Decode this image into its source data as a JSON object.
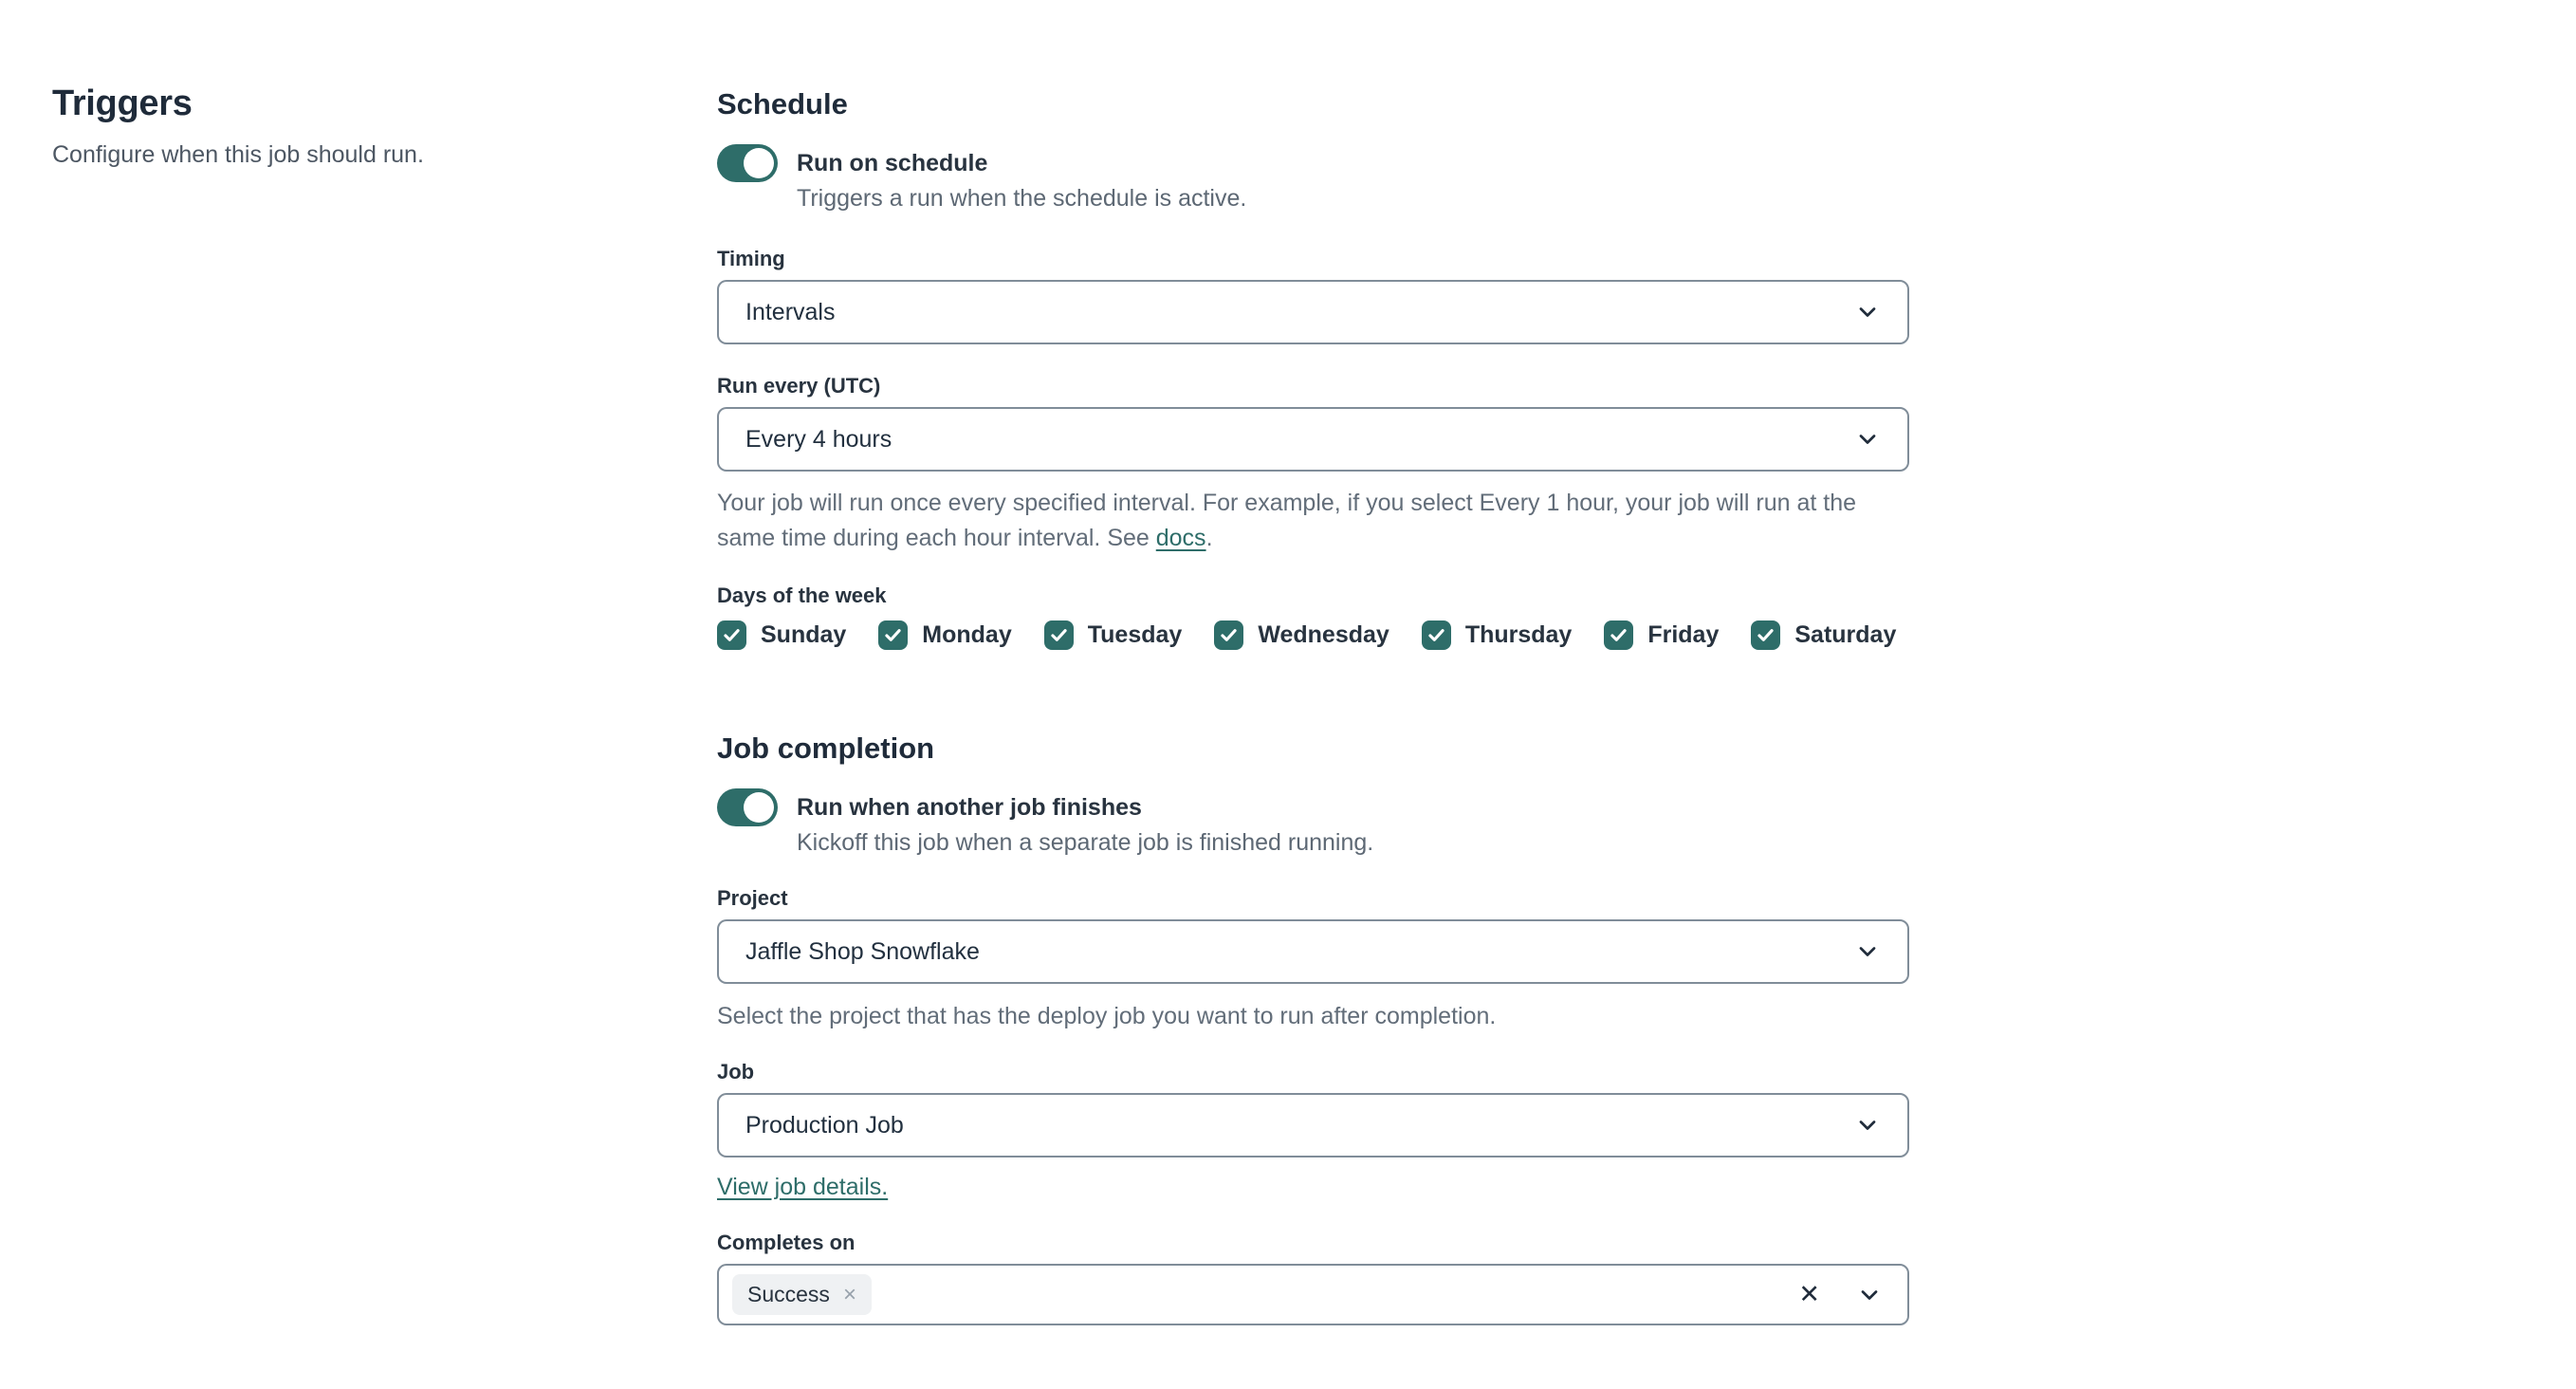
{
  "left": {
    "title": "Triggers",
    "subtitle": "Configure when this job should run."
  },
  "schedule": {
    "heading": "Schedule",
    "toggle": {
      "label": "Run on schedule",
      "description": "Triggers a run when the schedule is active.",
      "state": "on"
    },
    "timing": {
      "label": "Timing",
      "value": "Intervals"
    },
    "run_every": {
      "label": "Run every (UTC)",
      "value": "Every 4 hours",
      "help_before": "Your job will run once every specified interval. For example, if you select Every 1 hour, your job will run at the same time during each hour interval. See ",
      "help_link": "docs",
      "help_after": "."
    },
    "days": {
      "label": "Days of the week",
      "items": [
        {
          "label": "Sunday",
          "checked": true
        },
        {
          "label": "Monday",
          "checked": true
        },
        {
          "label": "Tuesday",
          "checked": true
        },
        {
          "label": "Wednesday",
          "checked": true
        },
        {
          "label": "Thursday",
          "checked": true
        },
        {
          "label": "Friday",
          "checked": true
        },
        {
          "label": "Saturday",
          "checked": true
        }
      ]
    }
  },
  "job_completion": {
    "heading": "Job completion",
    "toggle": {
      "label": "Run when another job finishes",
      "description": "Kickoff this job when a separate job is finished running.",
      "state": "on"
    },
    "project": {
      "label": "Project",
      "value": "Jaffle Shop Snowflake",
      "help": "Select the project that has the deploy job you want to run after completion."
    },
    "job": {
      "label": "Job",
      "value": "Production Job",
      "link": "View job details."
    },
    "completes_on": {
      "label": "Completes on",
      "chips": [
        {
          "label": "Success"
        }
      ],
      "clear_icon": "✕"
    }
  },
  "colors": {
    "accent_teal": "#2e6d69",
    "text_dark": "#1f2b3a",
    "text_gray": "#5d6874",
    "border": "#808d99",
    "chip_bg": "#eff1f3"
  }
}
